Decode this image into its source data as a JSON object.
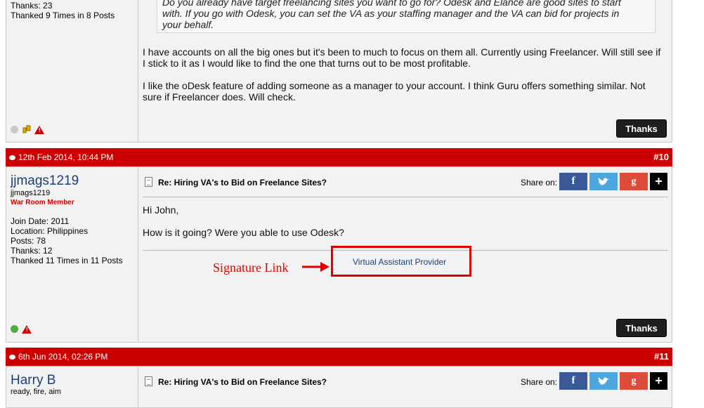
{
  "post9": {
    "stats": [
      "Thanks: 23",
      "Thanked 9 Times in 8 Posts"
    ],
    "quote_lines": [
      "Do you already have target freelancing sites you want to go for? Odesk and Elance are good sites to start",
      "with. If you go with Odesk, you can set the VA as your staffing manager and the VA can bid for projects in",
      "your behalf."
    ],
    "paragraphs": [
      "I have accounts on all the big ones but it's been to much to focus on them all. Currently using Freelancer. Will still see if I stick to it as I would like to find the one that turns out to be most profitable.",
      "I like the oDesk feature of adding someone as a manager to your account. I think Guru offers something similar. Not sure if Freelancer does. Will check."
    ],
    "thanks_label": "Thanks"
  },
  "post10": {
    "date": "12th Feb 2014, 10:44 PM",
    "number": "#10",
    "username": "jjmags1219",
    "subname": "jjmags1219",
    "rank": "War Room Member",
    "join_date": "Join Date: 2011",
    "location": "Location: Philippines",
    "posts": "Posts: 78",
    "thanks": "Thanks: 12",
    "thanked": "Thanked 11 Times in 11 Posts",
    "title": "Re: Hiring VA's to Bid on Freelance Sites?",
    "share_label": "Share on:",
    "greeting": "Hi John,",
    "message": "How is it going? Were you able to use Odesk?",
    "signature_link": "Virtual Assistant Provider",
    "annotation": "Signature Link",
    "thanks_label": "Thanks"
  },
  "post11": {
    "date": "6th Jun 2014, 02:26 PM",
    "number": "#11",
    "username": "Harry B",
    "subname": "ready, fire, aim",
    "title": "Re: Hiring VA's to Bid on Freelance Sites?",
    "share_label": "Share on:"
  },
  "share": {
    "facebook": "f",
    "google": "g",
    "more": "+"
  },
  "colors": {
    "header": "#cc0000",
    "username": "#1a3f7a",
    "link": "#1a3f7a",
    "annotation": "#e00000"
  }
}
